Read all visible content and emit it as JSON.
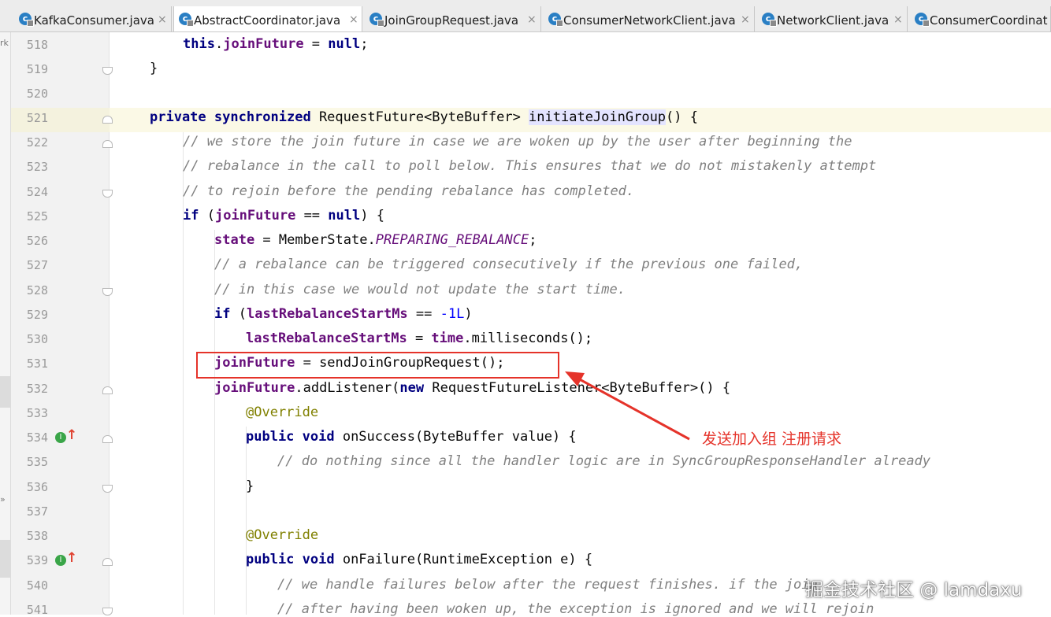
{
  "tabs": [
    {
      "name": "KafkaConsumer.java",
      "active": false
    },
    {
      "name": "AbstractCoordinator.java",
      "active": true
    },
    {
      "name": "JoinGroupRequest.java",
      "active": false
    },
    {
      "name": "ConsumerNetworkClient.java",
      "active": false
    },
    {
      "name": "NetworkClient.java",
      "active": false
    },
    {
      "name": "ConsumerCoordinat",
      "active": false
    }
  ],
  "tab_close_glyph": "×",
  "left_strip": {
    "text_top": "rk",
    "text_bottom": "»"
  },
  "lines": [
    {
      "no": "518",
      "tokens": [
        [
          "f",
          "this"
        ],
        [
          "p",
          "."
        ],
        [
          "fd",
          "joinFuture"
        ],
        [
          "p",
          " = "
        ],
        [
          "k",
          "null"
        ],
        [
          "p",
          ";"
        ]
      ]
    },
    {
      "no": "519",
      "tokens": [
        [
          "p",
          "}"
        ]
      ]
    },
    {
      "no": "520",
      "tokens": []
    },
    {
      "no": "521",
      "tokens": [
        [
          "k",
          "private synchronized"
        ],
        [
          "p",
          " RequestFuture<ByteBuffer> "
        ],
        [
          "mh",
          "initiateJoinGroup"
        ],
        [
          "p",
          "() {"
        ]
      ]
    },
    {
      "no": "522",
      "tokens": [
        [
          "c",
          "// we store the join future in case we are woken up by the user after beginning the"
        ]
      ]
    },
    {
      "no": "523",
      "tokens": [
        [
          "c",
          "// rebalance in the call to poll below. This ensures that we do not mistakenly attempt"
        ]
      ]
    },
    {
      "no": "524",
      "tokens": [
        [
          "c",
          "// to rejoin before the pending rebalance has completed."
        ]
      ]
    },
    {
      "no": "525",
      "tokens": [
        [
          "k",
          "if"
        ],
        [
          "p",
          " ("
        ],
        [
          "fd",
          "joinFuture"
        ],
        [
          "p",
          " == "
        ],
        [
          "k",
          "null"
        ],
        [
          "p",
          ") {"
        ]
      ]
    },
    {
      "no": "526",
      "tokens": [
        [
          "fd",
          "state"
        ],
        [
          "p",
          " = MemberState."
        ],
        [
          "cn",
          "PREPARING_REBALANCE"
        ],
        [
          "p",
          ";"
        ]
      ]
    },
    {
      "no": "527",
      "tokens": [
        [
          "c",
          "// a rebalance can be triggered consecutively if the previous one failed,"
        ]
      ]
    },
    {
      "no": "528",
      "tokens": [
        [
          "c",
          "// in this case we would not update the start time."
        ]
      ]
    },
    {
      "no": "529",
      "tokens": [
        [
          "k",
          "if"
        ],
        [
          "p",
          " ("
        ],
        [
          "fd",
          "lastRebalanceStartMs"
        ],
        [
          "p",
          " == "
        ],
        [
          "n",
          "-1L"
        ],
        [
          "p",
          ")"
        ]
      ]
    },
    {
      "no": "530",
      "tokens": [
        [
          "fd",
          "lastRebalanceStartMs"
        ],
        [
          "p",
          " = "
        ],
        [
          "fd",
          "time"
        ],
        [
          "p",
          ".milliseconds();"
        ]
      ]
    },
    {
      "no": "531",
      "tokens": [
        [
          "fd",
          "joinFuture"
        ],
        [
          "p",
          " = sendJoinGroupRequest();"
        ]
      ]
    },
    {
      "no": "532",
      "tokens": [
        [
          "fd",
          "joinFuture"
        ],
        [
          "p",
          ".addListener("
        ],
        [
          "k",
          "new"
        ],
        [
          "p",
          " RequestFutureListener<ByteBuffer>() {"
        ]
      ]
    },
    {
      "no": "533",
      "tokens": [
        [
          "a",
          "@Override"
        ]
      ]
    },
    {
      "no": "534",
      "tokens": [
        [
          "k",
          "public void"
        ],
        [
          "p",
          " onSuccess(ByteBuffer value) {"
        ]
      ]
    },
    {
      "no": "535",
      "tokens": [
        [
          "c",
          "// do nothing since all the handler logic are in SyncGroupResponseHandler already"
        ]
      ]
    },
    {
      "no": "536",
      "tokens": [
        [
          "p",
          "}"
        ]
      ]
    },
    {
      "no": "537",
      "tokens": []
    },
    {
      "no": "538",
      "tokens": [
        [
          "a",
          "@Override"
        ]
      ]
    },
    {
      "no": "539",
      "tokens": [
        [
          "k",
          "public void"
        ],
        [
          "p",
          " onFailure(RuntimeException e) {"
        ]
      ]
    },
    {
      "no": "540",
      "tokens": [
        [
          "c",
          "// we handle failures below after the request finishes. if the join"
        ]
      ]
    },
    {
      "no": "541",
      "tokens": [
        [
          "c",
          "// after having been woken up, the exception is ignored and we will rejoin"
        ]
      ]
    }
  ],
  "gutter_markers": {
    "implements_glyph": "I",
    "arrow_glyph": "↑"
  },
  "annotation": {
    "text": "发送加入组 注册请求",
    "color": "#e5332a"
  },
  "watermark": "掘金技术社区 @ lamdaxu",
  "colors": {
    "keyword": "#000080",
    "field": "#660e7a",
    "comment": "#808080",
    "number": "#0000ff",
    "annotation": "#808000",
    "highlight_line": "#fbf9e6",
    "method_highlight": "#e4e4ff"
  }
}
